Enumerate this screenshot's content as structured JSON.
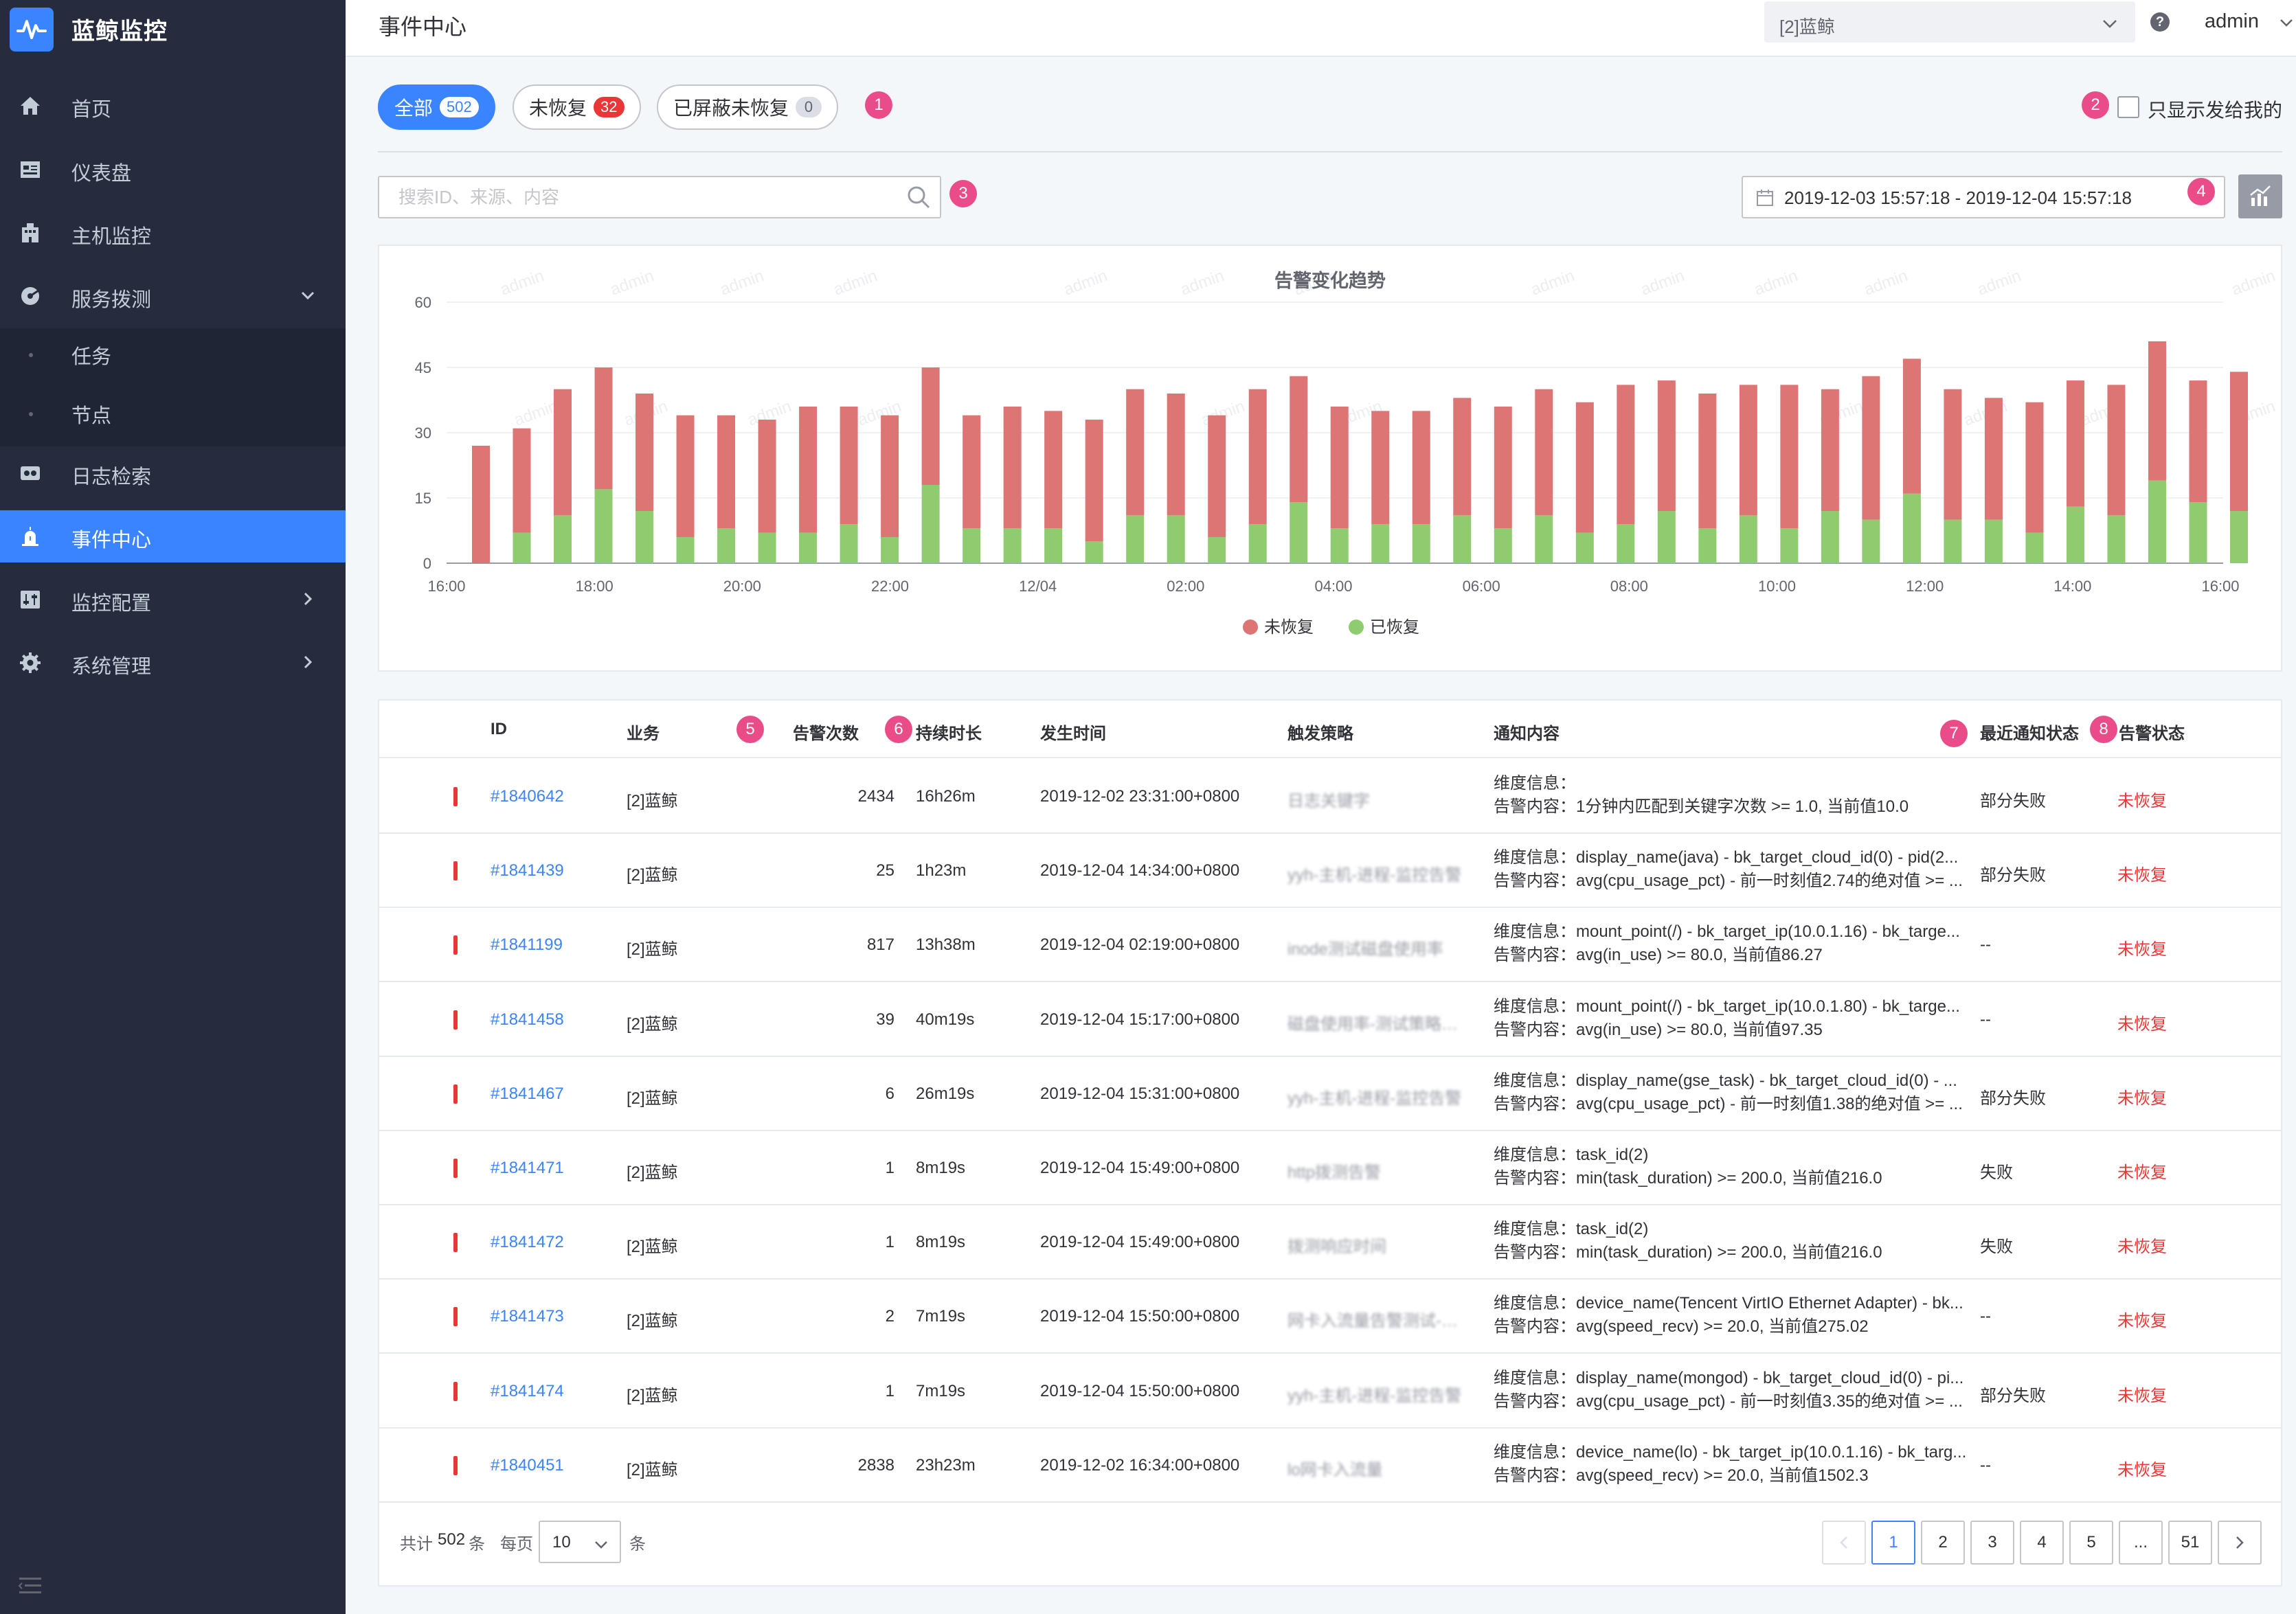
{
  "app": {
    "name": "蓝鲸监控"
  },
  "sidebar": {
    "items": [
      {
        "label": "首页",
        "icon": "home-icon"
      },
      {
        "label": "仪表盘",
        "icon": "dashboard-icon"
      },
      {
        "label": "主机监控",
        "icon": "host-icon"
      },
      {
        "label": "服务拨测",
        "icon": "probe-icon",
        "expanded": true,
        "children": [
          {
            "label": "任务"
          },
          {
            "label": "节点"
          }
        ]
      },
      {
        "label": "日志检索",
        "icon": "log-icon"
      },
      {
        "label": "事件中心",
        "icon": "event-icon",
        "active": true
      },
      {
        "label": "监控配置",
        "icon": "config-icon"
      },
      {
        "label": "系统管理",
        "icon": "settings-icon"
      }
    ]
  },
  "header": {
    "title": "事件中心",
    "business": "[2]蓝鲸",
    "user": "admin"
  },
  "tabs": [
    {
      "label": "全部",
      "count": "502",
      "active": true
    },
    {
      "label": "未恢复",
      "count": "32"
    },
    {
      "label": "已屏蔽未恢复",
      "count": "0"
    }
  ],
  "steps": [
    "1",
    "2",
    "3",
    "4",
    "5",
    "6",
    "7",
    "8"
  ],
  "only_mine_label": "只显示发给我的",
  "search": {
    "placeholder": "搜索ID、来源、内容"
  },
  "date_range": "2019-12-03 15:57:18 - 2019-12-04 15:57:18",
  "watermark": "admin",
  "chart_data": {
    "type": "bar",
    "title": "告警变化趋势",
    "stacked": true,
    "ylim": [
      0,
      60
    ],
    "yticks": [
      0,
      15,
      30,
      45,
      60
    ],
    "xticks": [
      "16:00",
      "18:00",
      "20:00",
      "22:00",
      "12/04",
      "02:00",
      "04:00",
      "06:00",
      "08:00",
      "10:00",
      "12:00",
      "14:00",
      "16:00"
    ],
    "legend_position": "bottom",
    "series": [
      {
        "name": "已恢复",
        "color": "#8fcc70",
        "values": [
          0,
          7,
          11,
          17,
          12,
          6,
          8,
          7,
          7,
          9,
          6,
          18,
          8,
          8,
          8,
          5,
          11,
          11,
          6,
          9,
          14,
          8,
          9,
          9,
          11,
          8,
          11,
          7,
          9,
          12,
          8,
          11,
          8,
          12,
          10,
          16,
          10,
          10,
          7,
          13,
          11,
          19,
          14,
          12
        ]
      },
      {
        "name": "未恢复",
        "color": "#dd7575",
        "values": [
          27,
          24,
          29,
          28,
          27,
          28,
          26,
          26,
          29,
          27,
          28,
          27,
          26,
          28,
          27,
          28,
          29,
          28,
          28,
          31,
          29,
          28,
          26,
          26,
          27,
          28,
          29,
          30,
          32,
          30,
          31,
          30,
          33,
          28,
          33,
          31,
          30,
          28,
          30,
          29,
          30,
          32,
          28,
          32
        ]
      }
    ]
  },
  "table": {
    "columns": [
      "ID",
      "业务",
      "告警次数",
      "持续时长",
      "发生时间",
      "触发策略",
      "通知内容",
      "最近通知状态",
      "告警状态"
    ],
    "rows": [
      {
        "id": "#1840642",
        "biz": "[2]蓝鲸",
        "count": "2434",
        "duration": "16h26m",
        "time": "2019-12-02 23:31:00+0800",
        "policy": "日志关键字",
        "dim": "维度信息：",
        "content": "告警内容：1分钟内匹配到关键字次数 >= 1.0, 当前值10.0",
        "notice": "部分失败",
        "status": "未恢复"
      },
      {
        "id": "#1841439",
        "biz": "[2]蓝鲸",
        "count": "25",
        "duration": "1h23m",
        "time": "2019-12-04 14:34:00+0800",
        "policy": "yyh-主机-进程-监控告警",
        "dim": "维度信息：display_name(java) - bk_target_cloud_id(0) - pid(2...",
        "content": "告警内容：avg(cpu_usage_pct) - 前一时刻值2.74的绝对值 >= ...",
        "notice": "部分失败",
        "status": "未恢复"
      },
      {
        "id": "#1841199",
        "biz": "[2]蓝鲸",
        "count": "817",
        "duration": "13h38m",
        "time": "2019-12-04 02:19:00+0800",
        "policy": "inode测试磁盘使用率",
        "dim": "维度信息：mount_point(/) - bk_target_ip(10.0.1.16) - bk_targe...",
        "content": "告警内容：avg(in_use) >= 80.0, 当前值86.27",
        "notice": "--",
        "status": "未恢复"
      },
      {
        "id": "#1841458",
        "biz": "[2]蓝鲸",
        "count": "39",
        "duration": "40m19s",
        "time": "2019-12-04 15:17:00+0800",
        "policy": "磁盘使用率-测试策略告警",
        "dim": "维度信息：mount_point(/) - bk_target_ip(10.0.1.80) - bk_targe...",
        "content": "告警内容：avg(in_use) >= 80.0, 当前值97.35",
        "notice": "--",
        "status": "未恢复"
      },
      {
        "id": "#1841467",
        "biz": "[2]蓝鲸",
        "count": "6",
        "duration": "26m19s",
        "time": "2019-12-04 15:31:00+0800",
        "policy": "yyh-主机-进程-监控告警",
        "dim": "维度信息：display_name(gse_task) - bk_target_cloud_id(0) - ...",
        "content": "告警内容：avg(cpu_usage_pct) - 前一时刻值1.38的绝对值 >= ...",
        "notice": "部分失败",
        "status": "未恢复"
      },
      {
        "id": "#1841471",
        "biz": "[2]蓝鲸",
        "count": "1",
        "duration": "8m19s",
        "time": "2019-12-04 15:49:00+0800",
        "policy": "http拨测告警",
        "dim": "维度信息：task_id(2)",
        "content": "告警内容：min(task_duration) >= 200.0, 当前值216.0",
        "notice": "失败",
        "status": "未恢复"
      },
      {
        "id": "#1841472",
        "biz": "[2]蓝鲸",
        "count": "1",
        "duration": "8m19s",
        "time": "2019-12-04 15:49:00+0800",
        "policy": "拨测响应时间",
        "dim": "维度信息：task_id(2)",
        "content": "告警内容：min(task_duration) >= 200.0, 当前值216.0",
        "notice": "失败",
        "status": "未恢复"
      },
      {
        "id": "#1841473",
        "biz": "[2]蓝鲸",
        "count": "2",
        "duration": "7m19s",
        "time": "2019-12-04 15:50:00+0800",
        "policy": "网卡入流量告警测试-bond",
        "dim": "维度信息：device_name(Tencent VirtIO Ethernet Adapter) - bk...",
        "content": "告警内容：avg(speed_recv) >= 20.0, 当前值275.02",
        "notice": "--",
        "status": "未恢复"
      },
      {
        "id": "#1841474",
        "biz": "[2]蓝鲸",
        "count": "1",
        "duration": "7m19s",
        "time": "2019-12-04 15:50:00+0800",
        "policy": "yyh-主机-进程-监控告警",
        "dim": "维度信息：display_name(mongod) - bk_target_cloud_id(0) - pi...",
        "content": "告警内容：avg(cpu_usage_pct) - 前一时刻值3.35的绝对值 >= ...",
        "notice": "部分失败",
        "status": "未恢复"
      },
      {
        "id": "#1840451",
        "biz": "[2]蓝鲸",
        "count": "2838",
        "duration": "23h23m",
        "time": "2019-12-02 16:34:00+0800",
        "policy": "lo网卡入流量",
        "dim": "维度信息：device_name(lo) - bk_target_ip(10.0.1.16) - bk_targ...",
        "content": "告警内容：avg(speed_recv) >= 20.0, 当前值1502.3",
        "notice": "--",
        "status": "未恢复"
      }
    ]
  },
  "pagination": {
    "total_prefix": "共计",
    "total": "502",
    "total_suffix": "条",
    "per_page_label": "每页",
    "page_size": "10",
    "per_page_suffix": "条",
    "pages": [
      "1",
      "2",
      "3",
      "4",
      "5",
      "...",
      "51"
    ],
    "current": "1"
  }
}
